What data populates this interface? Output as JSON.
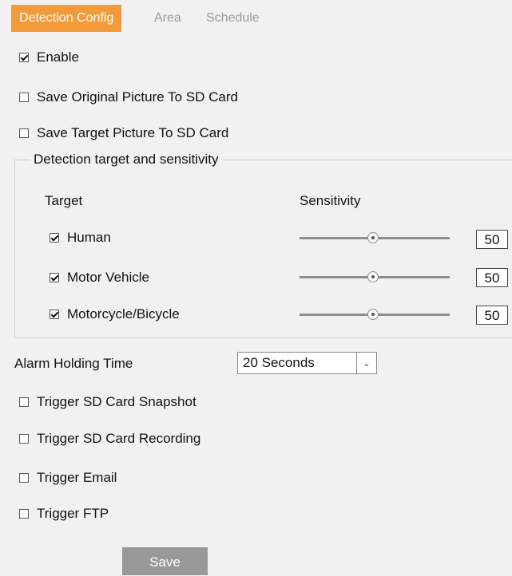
{
  "tabs": [
    {
      "label": "Detection Config",
      "active": true
    },
    {
      "label": "Area",
      "active": false
    },
    {
      "label": "Schedule",
      "active": false
    }
  ],
  "options": {
    "enable": {
      "label": "Enable",
      "checked": true
    },
    "save_original": {
      "label": "Save Original Picture To SD Card",
      "checked": false
    },
    "save_target": {
      "label": "Save Target Picture To SD Card",
      "checked": false
    }
  },
  "detection": {
    "legend": "Detection target and sensitivity",
    "target_header": "Target",
    "sensitivity_header": "Sensitivity",
    "targets": [
      {
        "label": "Human",
        "checked": true,
        "sensitivity": "50"
      },
      {
        "label": "Motor Vehicle",
        "checked": true,
        "sensitivity": "50"
      },
      {
        "label": "Motorcycle/Bicycle",
        "checked": true,
        "sensitivity": "50"
      }
    ]
  },
  "alarm": {
    "label": "Alarm Holding Time",
    "value": "20 Seconds"
  },
  "triggers": [
    {
      "label": "Trigger SD Card Snapshot",
      "checked": false
    },
    {
      "label": "Trigger SD Card Recording",
      "checked": false
    },
    {
      "label": "Trigger Email",
      "checked": false
    },
    {
      "label": "Trigger FTP",
      "checked": false
    }
  ],
  "save_label": "Save",
  "colors": {
    "accent": "#f39b3b",
    "button": "#999999",
    "background": "#f1f1f1"
  }
}
